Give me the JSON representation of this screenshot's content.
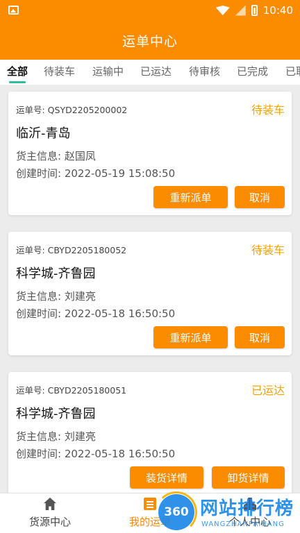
{
  "status_bar": {
    "time": "10:40"
  },
  "app_bar": {
    "title": "运单中心"
  },
  "tabs": [
    "全部",
    "待装车",
    "运输中",
    "已运达",
    "待审核",
    "已完成",
    "已取"
  ],
  "cards": [
    {
      "order_no": "运单号: QSYD2205200002",
      "status": "待装车",
      "route": "临沂-青岛",
      "owner": "货主信息: 赵国凤",
      "created": "创建时间: 2022-05-19 15:08:50",
      "buttons": [
        "重新派单",
        "取消"
      ]
    },
    {
      "order_no": "运单号: CBYD2205180052",
      "status": "待装车",
      "route": "科学城-齐鲁园",
      "owner": "货主信息: 刘建亮",
      "created": "创建时间: 2022-05-18 16:50:50",
      "buttons": [
        "重新派单",
        "取消"
      ]
    },
    {
      "order_no": "运单号: CBYD2205180051",
      "status": "已运达",
      "route": "科学城-齐鲁园",
      "owner": "货主信息: 刘建亮",
      "created": "创建时间: 2022-05-18 16:50:50",
      "buttons": [
        "装货详情",
        "卸货详情"
      ]
    }
  ],
  "bottom_nav": [
    {
      "label": "货源中心",
      "icon": "home-icon"
    },
    {
      "label": "我的运单",
      "icon": "document-icon"
    },
    {
      "label": "个人中心",
      "icon": "person-icon"
    }
  ],
  "watermark": {
    "logo": "360",
    "main": "网站排行榜",
    "sub": "WANGZHANPAIHANG"
  },
  "colors": {
    "accent": "#fb8c00",
    "status": "#f5a20a",
    "tab_indicator": "#2bbd9e",
    "watermark": "#1e88e5"
  }
}
